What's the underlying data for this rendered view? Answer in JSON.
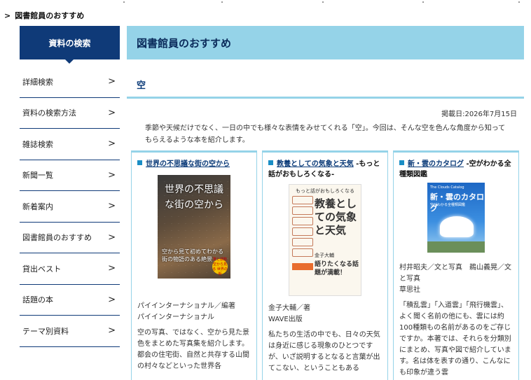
{
  "breadcrumb": {
    "arrow": ">",
    "label": "図書館員のおすすめ"
  },
  "sidebar": {
    "heading": "資料の検索",
    "items": [
      {
        "label": "詳細検索"
      },
      {
        "label": "資料の検索方法"
      },
      {
        "label": "雑誌検索"
      },
      {
        "label": "新聞一覧"
      },
      {
        "label": "新着案内"
      },
      {
        "label": "図書館員のおすすめ"
      },
      {
        "label": "貸出ベスト"
      },
      {
        "label": "話題の本"
      },
      {
        "label": "テーマ別資料"
      }
    ],
    "chevron": ">"
  },
  "main": {
    "title": "図書館員のおすすめ",
    "section_title": "空",
    "posted": "掲載日:2026年7月15日",
    "intro": "季節や天候だけでなく、一日の中でも様々な表情をみせてくれる「空」。今回は、そんな空を色んな角度から知ってもらえるような本を紹介します。"
  },
  "books": [
    {
      "title_link": "世界の不思議な街の空から",
      "title_rest": "",
      "cover": {
        "title": "世界の不思議な街の空から",
        "bottom": "空から見て初めてわかる 街の物語のある絶景",
        "badge": "驚と感動 空から見る 世界の街"
      },
      "meta": [
        "パイインターナショナル／編著",
        "パイインターナショナル"
      ],
      "desc": "空の写真、ではなく、空から見た景色をまとめた写真集を紹介します。都会の住宅街、自然と共存する山間の村々などといった世界各"
    },
    {
      "title_link": "教養としての気象と天気",
      "title_rest": " -もっと話がおもしろくなる-",
      "cover": {
        "top": "もっと話がおもしろくなる",
        "big": "教養としての気象と天気",
        "author": "金子大輔",
        "sub": "語りたくなる話題が満載！"
      },
      "meta": [
        "金子大輔／著",
        "WAVE出版"
      ],
      "desc": "私たちの生活の中でも、日々の天気は身近に感じる現象のひとつですが、いざ説明するとなると言葉が出てこない、ということもある"
    },
    {
      "title_link": "新・雲のカタログ",
      "title_rest": " -空がわかる全種類図鑑",
      "cover": {
        "en": "The Clouds Catalog",
        "title": "新・雲のカタログ",
        "sub": "空がわかる全種類図鑑"
      },
      "meta": [
        "村井昭夫／文と写真　鵜山義晃／文と写真",
        "草思社"
      ],
      "desc": "「積乱雲」「入道雲」「飛行機雲」、よく聞く名前の他にも、雲には約100種類もの名前があるのをご存じですか。本著では、それらを分類別にまとめ、写真や図で紹介しています。名は体を表すの通り、こんなにも印象が違う雲"
    }
  ],
  "colors": {
    "navy": "#0f3a78",
    "band": "#95d3e8",
    "marker": "#1a8ec5"
  }
}
